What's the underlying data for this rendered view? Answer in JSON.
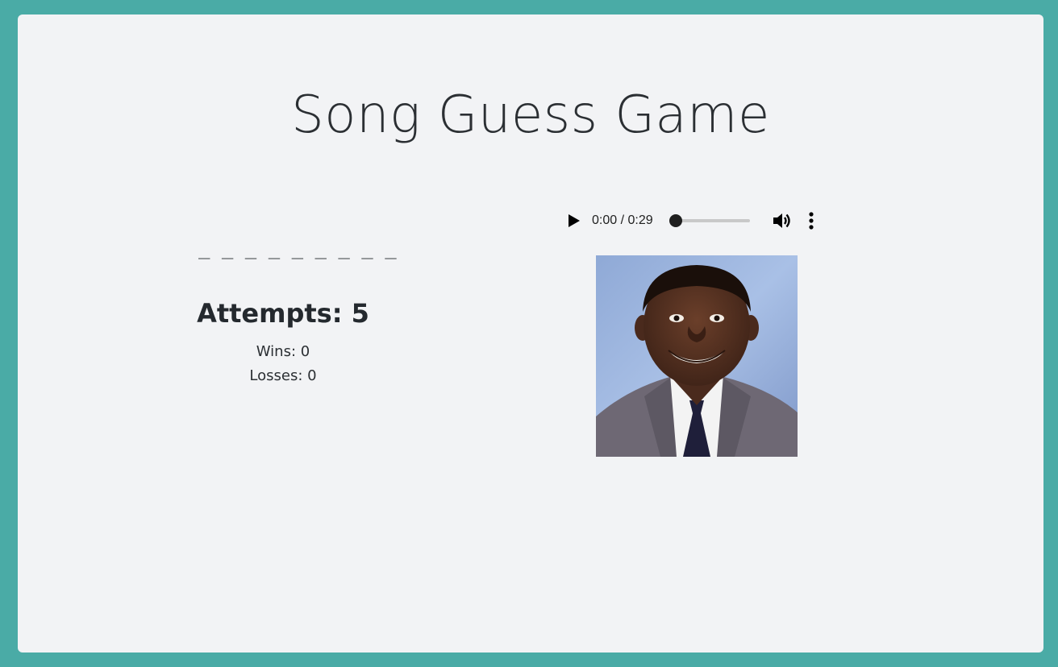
{
  "game": {
    "title": "Song Guess Game",
    "word_blanks": "_ _ _ _ _ _ _ _ _",
    "attempts_label": "Attempts: 5",
    "wins_label": "Wins: 0",
    "losses_label": "Losses: 0"
  },
  "audio_player": {
    "time_display": "0:00 / 0:29",
    "progress_fraction": 0,
    "icons": [
      "play-icon",
      "volume-icon",
      "more-options-icon"
    ]
  },
  "artist_photo": {
    "subject": "portrait-photo"
  },
  "colors": {
    "frame": "#4aaba6",
    "card": "#f2f3f5"
  }
}
